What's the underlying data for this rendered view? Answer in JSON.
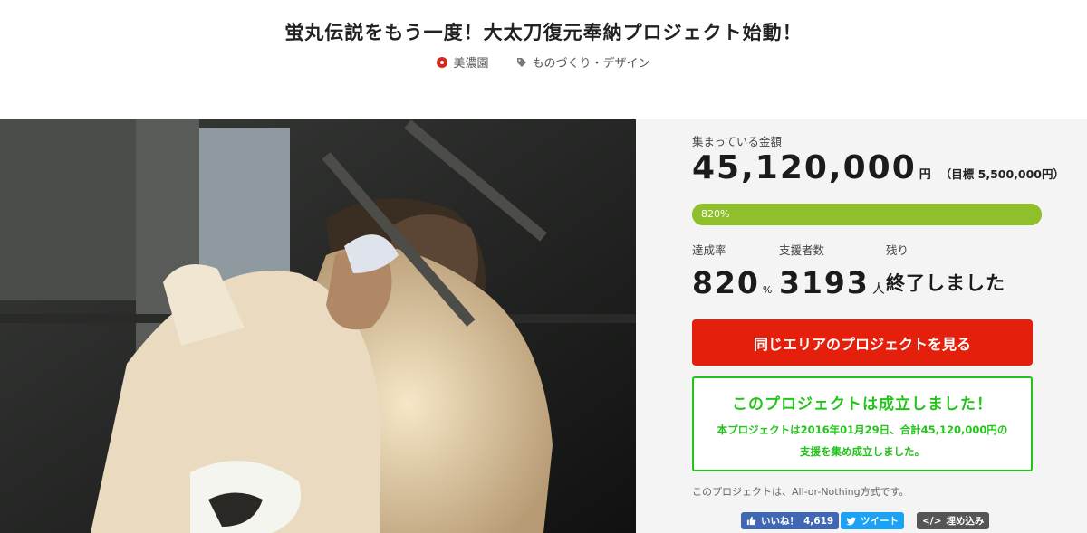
{
  "project": {
    "title": "蛍丸伝説をもう一度！大太刀復元奉納プロジェクト始動！",
    "location": "美濃園",
    "category": "ものづくり・デザイン"
  },
  "funding": {
    "amount_label": "集まっている金額",
    "amount": "45,120,000",
    "amount_unit": "円",
    "goal_text": "（目標 5,500,000円）",
    "progress_text": "820%",
    "progress_fraction": 1.0,
    "rate_label": "達成率",
    "rate_value": "820",
    "rate_unit": "%",
    "backers_label": "支援者数",
    "backers_value": "3193",
    "backers_unit": "人",
    "remaining_label": "残り",
    "remaining_value": "終了しました"
  },
  "actions": {
    "area_button": "同じエリアのプロジェクトを見る"
  },
  "success_box": {
    "title": "このプロジェクトは成立しました！",
    "line1": "本プロジェクトは2016年01月29日、合計45,120,000円の",
    "line2": "支援を集め成立しました。"
  },
  "note": "このプロジェクトは、All-or-Nothing方式です。",
  "share": {
    "facebook_label": "いいね！",
    "facebook_count": "4,619",
    "twitter_label": "ツイート",
    "embed_label": "埋め込み"
  },
  "colors": {
    "accent_red": "#e4200c",
    "progress_green": "#8fc02b",
    "success_green": "#23c41a"
  },
  "icons": {
    "location": "location-pin-icon",
    "category": "tag-icon",
    "facebook": "thumbs-up-icon",
    "twitter": "bird-icon",
    "embed": "code-icon"
  }
}
